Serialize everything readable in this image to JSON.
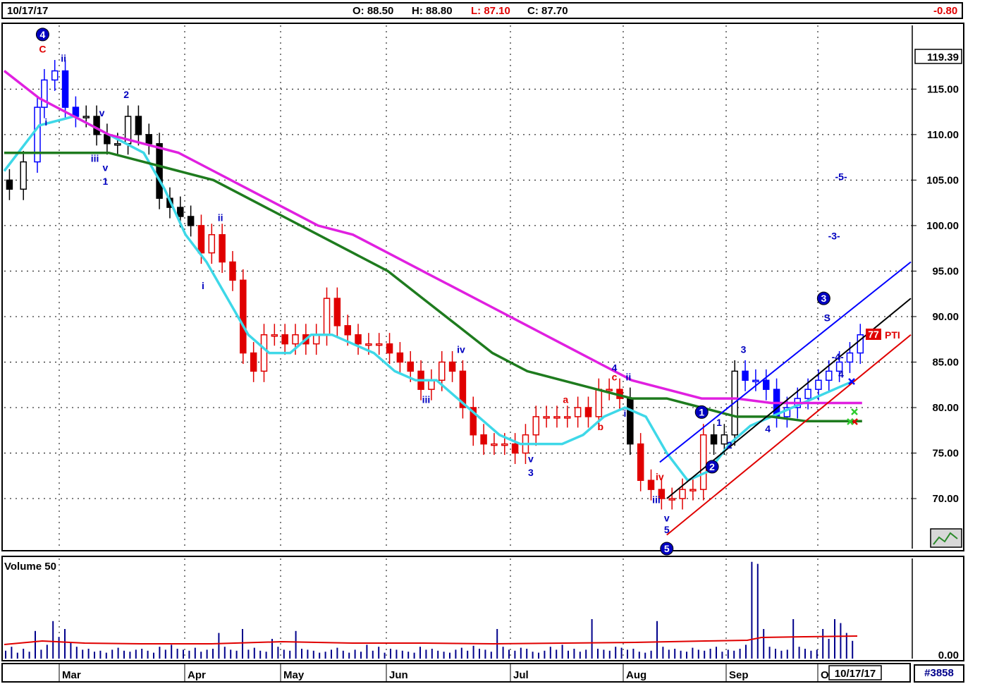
{
  "header": {
    "date": "10/17/17",
    "open": "O: 88.50",
    "high": "H: 88.80",
    "low": "L: 87.10",
    "close": "C: 87.70",
    "change": "-0.80"
  },
  "symbol_id": "#3858",
  "volume_title": "Volume 50",
  "x_cursor_label": "10/17/17",
  "current_price_label": "119.39",
  "pti_label": "PTI",
  "pti_value": "77",
  "chart_data": {
    "type": "candlestick",
    "y_axis": {
      "ticks": [
        "115.00",
        "110.00",
        "105.00",
        "100.00",
        "95.00",
        "90.00",
        "85.00",
        "80.00",
        "75.00",
        "70.00"
      ],
      "tick_values": [
        115,
        110,
        105,
        100,
        95,
        90,
        85,
        80,
        75,
        70
      ],
      "ylim": [
        65,
        122
      ]
    },
    "x_axis": {
      "months": [
        "Mar",
        "Apr",
        "May",
        "Jun",
        "Jul",
        "Aug",
        "Sep",
        "O"
      ]
    },
    "price_path": [
      [
        0,
        105
      ],
      [
        4,
        104
      ],
      [
        8,
        107
      ],
      [
        10,
        113
      ],
      [
        13,
        116
      ],
      [
        16,
        117
      ],
      [
        19,
        113
      ],
      [
        22,
        112
      ],
      [
        25,
        112
      ],
      [
        28,
        110
      ],
      [
        31,
        109
      ],
      [
        34,
        109
      ],
      [
        37,
        112
      ],
      [
        40,
        110
      ],
      [
        43,
        109
      ],
      [
        46,
        103
      ],
      [
        49,
        102
      ],
      [
        52,
        101
      ],
      [
        55,
        100
      ],
      [
        58,
        97
      ],
      [
        61,
        99
      ],
      [
        64,
        96
      ],
      [
        67,
        94
      ],
      [
        70,
        86
      ],
      [
        73,
        84
      ],
      [
        76,
        88
      ],
      [
        79,
        88
      ],
      [
        82,
        87
      ],
      [
        85,
        88
      ],
      [
        88,
        87
      ],
      [
        91,
        88
      ],
      [
        94,
        92
      ],
      [
        97,
        89
      ],
      [
        100,
        88
      ],
      [
        103,
        87
      ],
      [
        106,
        87
      ],
      [
        109,
        87
      ],
      [
        112,
        86
      ],
      [
        115,
        85
      ],
      [
        118,
        84
      ],
      [
        121,
        82
      ],
      [
        124,
        83
      ],
      [
        127,
        85
      ],
      [
        130,
        84
      ],
      [
        133,
        80
      ],
      [
        136,
        77
      ],
      [
        139,
        76
      ],
      [
        142,
        76
      ],
      [
        145,
        76
      ],
      [
        148,
        75
      ],
      [
        151,
        77
      ],
      [
        154,
        79
      ],
      [
        157,
        79
      ],
      [
        160,
        79
      ],
      [
        163,
        79
      ],
      [
        166,
        80
      ],
      [
        169,
        79
      ],
      [
        172,
        82
      ],
      [
        175,
        82
      ],
      [
        178,
        81
      ],
      [
        181,
        76
      ],
      [
        184,
        72
      ],
      [
        187,
        71
      ],
      [
        190,
        70
      ],
      [
        193,
        70
      ],
      [
        196,
        71
      ],
      [
        199,
        71
      ],
      [
        202,
        77
      ],
      [
        205,
        76
      ],
      [
        208,
        77
      ],
      [
        211,
        84
      ],
      [
        214,
        83
      ],
      [
        217,
        83
      ],
      [
        220,
        82
      ],
      [
        223,
        79
      ],
      [
        226,
        80
      ],
      [
        229,
        81
      ],
      [
        232,
        82
      ],
      [
        235,
        83
      ],
      [
        238,
        84
      ],
      [
        241,
        85
      ],
      [
        244,
        86
      ],
      [
        247,
        88
      ]
    ],
    "series": [
      {
        "name": "",
        "color": "#3ed8e8",
        "values": [
          [
            0,
            106
          ],
          [
            10,
            111
          ],
          [
            20,
            112
          ],
          [
            30,
            110
          ],
          [
            40,
            108
          ],
          [
            46,
            104
          ],
          [
            52,
            99
          ],
          [
            58,
            96
          ],
          [
            64,
            92
          ],
          [
            70,
            88
          ],
          [
            76,
            86
          ],
          [
            82,
            86
          ],
          [
            88,
            88
          ],
          [
            94,
            88
          ],
          [
            100,
            87
          ],
          [
            106,
            86
          ],
          [
            112,
            84
          ],
          [
            118,
            83
          ],
          [
            124,
            83
          ],
          [
            130,
            81
          ],
          [
            136,
            79
          ],
          [
            142,
            77
          ],
          [
            148,
            76
          ],
          [
            154,
            76
          ],
          [
            160,
            76
          ],
          [
            166,
            77
          ],
          [
            172,
            79
          ],
          [
            178,
            80
          ],
          [
            184,
            79
          ],
          [
            190,
            75
          ],
          [
            196,
            72
          ],
          [
            202,
            73
          ],
          [
            208,
            76
          ],
          [
            214,
            78
          ],
          [
            220,
            79
          ],
          [
            226,
            80
          ],
          [
            232,
            81
          ],
          [
            238,
            82
          ],
          [
            244,
            83
          ]
        ]
      },
      {
        "name": "",
        "color": "#1e7b1e",
        "values": [
          [
            0,
            108
          ],
          [
            10,
            108
          ],
          [
            20,
            108
          ],
          [
            30,
            108
          ],
          [
            40,
            107
          ],
          [
            50,
            106
          ],
          [
            60,
            105
          ],
          [
            70,
            103
          ],
          [
            80,
            101
          ],
          [
            90,
            99
          ],
          [
            100,
            97
          ],
          [
            110,
            95
          ],
          [
            120,
            92
          ],
          [
            130,
            89
          ],
          [
            140,
            86
          ],
          [
            150,
            84
          ],
          [
            160,
            83
          ],
          [
            170,
            82
          ],
          [
            180,
            81
          ],
          [
            190,
            81
          ],
          [
            200,
            80
          ],
          [
            210,
            79
          ],
          [
            220,
            79
          ],
          [
            230,
            78.5
          ],
          [
            240,
            78.5
          ],
          [
            246,
            78.5
          ]
        ]
      },
      {
        "name": "",
        "color": "#e020e0",
        "values": [
          [
            0,
            117
          ],
          [
            10,
            114
          ],
          [
            20,
            112
          ],
          [
            30,
            110
          ],
          [
            40,
            109
          ],
          [
            50,
            108
          ],
          [
            60,
            106
          ],
          [
            70,
            104
          ],
          [
            80,
            102
          ],
          [
            90,
            100
          ],
          [
            100,
            99
          ],
          [
            110,
            97
          ],
          [
            120,
            95
          ],
          [
            130,
            93
          ],
          [
            140,
            91
          ],
          [
            150,
            89
          ],
          [
            160,
            87
          ],
          [
            170,
            85
          ],
          [
            180,
            83
          ],
          [
            190,
            82
          ],
          [
            200,
            81
          ],
          [
            210,
            81
          ],
          [
            220,
            80.5
          ],
          [
            230,
            80.5
          ],
          [
            240,
            80.5
          ],
          [
            246,
            80.5
          ]
        ]
      }
    ],
    "channel_lines": [
      {
        "color": "#0000ff",
        "from": [
          188,
          74
        ],
        "to": [
          260,
          96
        ]
      },
      {
        "color": "#000000",
        "from": [
          190,
          70
        ],
        "to": [
          260,
          92
        ]
      },
      {
        "color": "#e00000",
        "from": [
          190,
          66
        ],
        "to": [
          260,
          88
        ]
      }
    ],
    "wave_labels": [
      {
        "text": "C",
        "x": 11,
        "y": 119,
        "color": "#e00000"
      },
      {
        "text": "ii",
        "x": 17,
        "y": 118,
        "color": "#0000c0"
      },
      {
        "text": "i",
        "x": 12,
        "y": 111,
        "color": "#0000c0"
      },
      {
        "text": "2",
        "x": 35,
        "y": 114,
        "color": "#0000c0"
      },
      {
        "text": "v",
        "x": 28,
        "y": 112,
        "color": "#0000c0"
      },
      {
        "text": "iii",
        "x": 26,
        "y": 107,
        "color": "#0000c0"
      },
      {
        "text": "v",
        "x": 29,
        "y": 106,
        "color": "#0000c0"
      },
      {
        "text": "1",
        "x": 29,
        "y": 104.5,
        "color": "#0000c0"
      },
      {
        "text": "ii",
        "x": 62,
        "y": 100.5,
        "color": "#0000c0"
      },
      {
        "text": "i",
        "x": 57,
        "y": 93,
        "color": "#0000c0"
      },
      {
        "text": "iv",
        "x": 131,
        "y": 86,
        "color": "#0000c0"
      },
      {
        "text": "iii",
        "x": 121,
        "y": 80.5,
        "color": "#0000c0"
      },
      {
        "text": "v",
        "x": 151,
        "y": 74,
        "color": "#0000c0"
      },
      {
        "text": "3",
        "x": 151,
        "y": 72.5,
        "color": "#0000c0"
      },
      {
        "text": "a",
        "x": 161,
        "y": 80.5,
        "color": "#e00000"
      },
      {
        "text": "b",
        "x": 171,
        "y": 77.5,
        "color": "#e00000"
      },
      {
        "text": "4",
        "x": 175,
        "y": 84,
        "color": "#0000c0"
      },
      {
        "text": "c",
        "x": 175,
        "y": 83,
        "color": "#e00000"
      },
      {
        "text": "ii",
        "x": 179,
        "y": 83,
        "color": "#0000c0"
      },
      {
        "text": "i",
        "x": 178,
        "y": 79,
        "color": "#0000c0"
      },
      {
        "text": "iv",
        "x": 188,
        "y": 72,
        "color": "#e00000"
      },
      {
        "text": "iii",
        "x": 187,
        "y": 69.5,
        "color": "#0000c0"
      },
      {
        "text": "v",
        "x": 190,
        "y": 67.5,
        "color": "#0000c0"
      },
      {
        "text": "5",
        "x": 190,
        "y": 66.2,
        "color": "#0000c0"
      },
      {
        "text": "1",
        "x": 205,
        "y": 78,
        "color": "#0000c0"
      },
      {
        "text": "2",
        "x": 208,
        "y": 75.5,
        "color": "#0000c0"
      },
      {
        "text": "3",
        "x": 212,
        "y": 86,
        "color": "#0000c0"
      },
      {
        "text": "4",
        "x": 219,
        "y": 77.3,
        "color": "#0000c0"
      },
      {
        "text": "S",
        "x": 236,
        "y": 89.5,
        "color": "#0000c0"
      },
      {
        "text": "-5-",
        "x": 240,
        "y": 105,
        "color": "#0000c0"
      },
      {
        "text": "-3-",
        "x": 238,
        "y": 98.5,
        "color": "#0000c0"
      },
      {
        "text": "-4-",
        "x": 239,
        "y": 85.2,
        "color": "#0000c0"
      },
      {
        "text": "4",
        "x": 240,
        "y": 83.3,
        "color": "#0000c0"
      }
    ],
    "circle_labels": [
      {
        "text": "4",
        "x": 11,
        "y": 121,
        "color": "#0000c0"
      },
      {
        "text": "5",
        "x": 190,
        "y": 64.5,
        "color": "#0000c0"
      },
      {
        "text": "1",
        "x": 200,
        "y": 79.5,
        "color": "#0000c0"
      },
      {
        "text": "2",
        "x": 203,
        "y": 73.5,
        "color": "#0000c0"
      },
      {
        "text": "3",
        "x": 235,
        "y": 92,
        "color": "#0000c0"
      }
    ],
    "volume": {
      "ylabel": "0.00",
      "avg_color": "#e00000",
      "bar_color": "#00008b"
    }
  }
}
